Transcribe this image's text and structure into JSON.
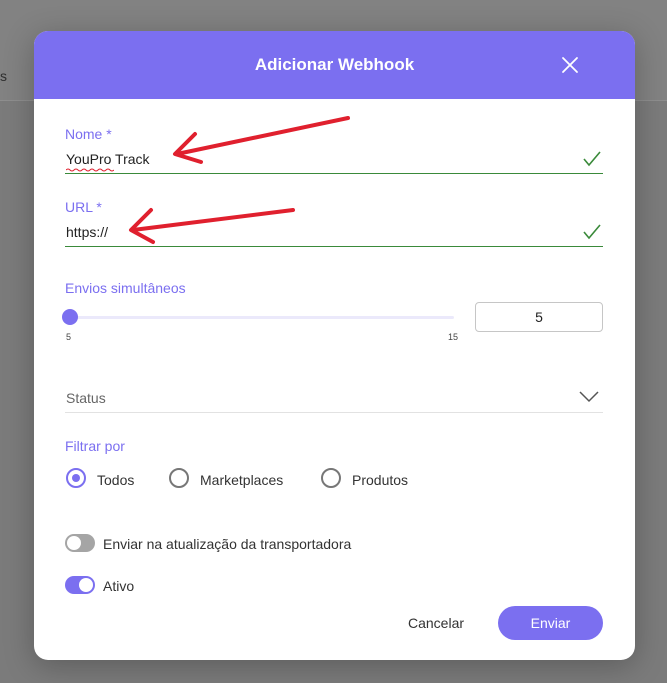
{
  "background": {
    "tab_fragment": "s"
  },
  "modal": {
    "title": "Adicionar Webhook",
    "close_icon": "close-icon"
  },
  "form": {
    "name": {
      "label": "Nome *",
      "value": "YouPro Track",
      "valid": true
    },
    "url": {
      "label": "URL *",
      "value": "https://",
      "valid": true
    },
    "concurrent": {
      "label": "Envios simultâneos",
      "min_label": "5",
      "max_label": "15",
      "min": 5,
      "max": 15,
      "value": "5"
    },
    "status": {
      "placeholder": "Status"
    },
    "filter": {
      "label": "Filtrar por",
      "options": [
        {
          "label": "Todos",
          "selected": true
        },
        {
          "label": "Marketplaces",
          "selected": false
        },
        {
          "label": "Produtos",
          "selected": false
        }
      ]
    },
    "toggles": {
      "carrier_update": {
        "label": "Enviar na atualização da transportadora",
        "on": false
      },
      "active": {
        "label": "Ativo",
        "on": true
      }
    }
  },
  "actions": {
    "cancel_label": "Cancelar",
    "submit_label": "Enviar"
  },
  "colors": {
    "accent": "#7b6ff0",
    "valid": "#3a8a3a",
    "annotation_arrow": "#e0202e"
  }
}
